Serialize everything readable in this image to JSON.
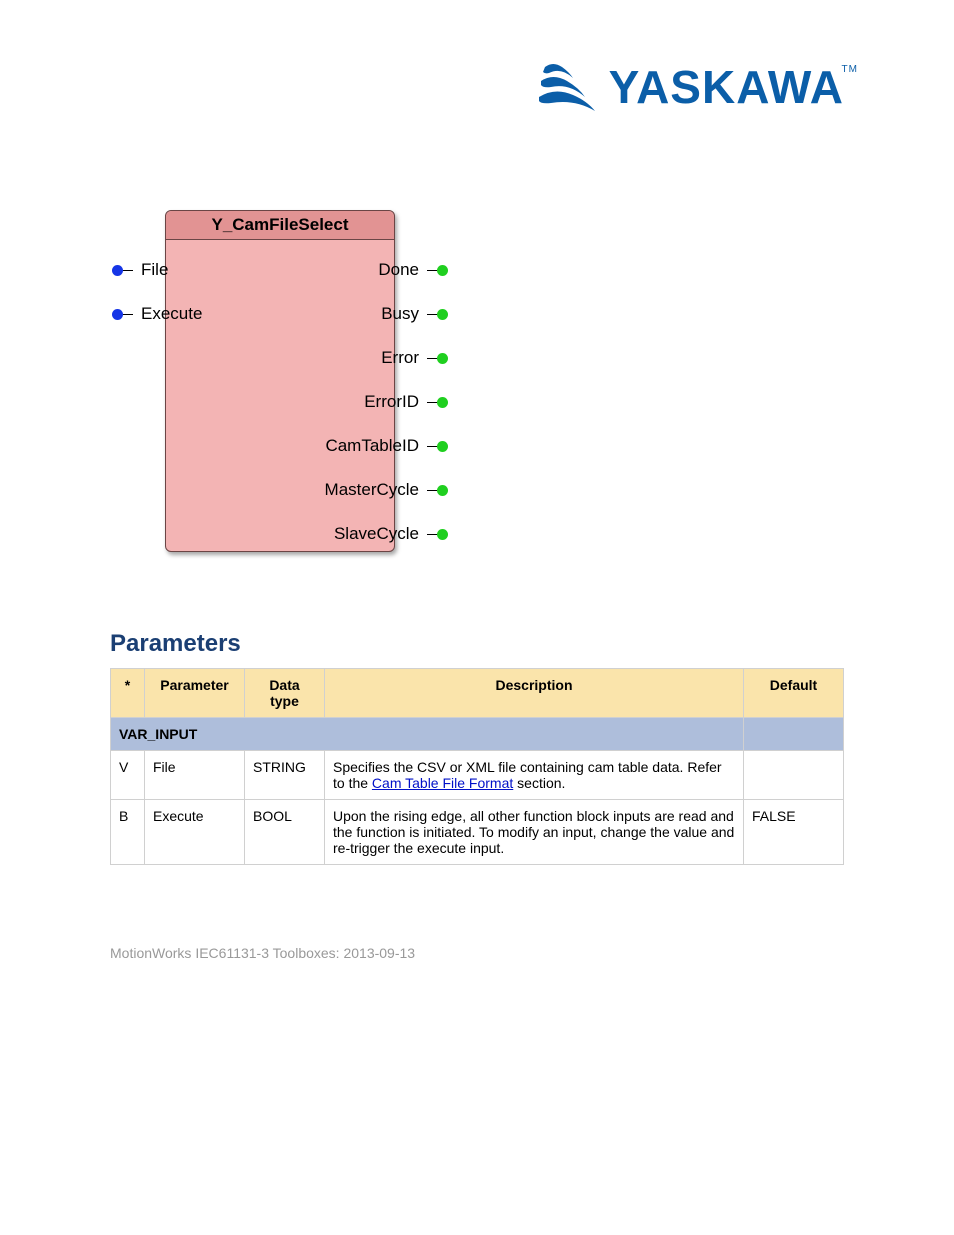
{
  "logo": {
    "text": "YASKAWA",
    "tm": "TM"
  },
  "block": {
    "title": "Y_CamFileSelect",
    "inputs": [
      "File",
      "Execute"
    ],
    "outputs": [
      "Done",
      "Busy",
      "Error",
      "ErrorID",
      "CamTableID",
      "MasterCycle",
      "SlaveCycle"
    ]
  },
  "parameters_heading": "Parameters",
  "columns": [
    "*",
    "Parameter",
    "Data type",
    "Description",
    "Default"
  ],
  "subhead": "VAR_INPUT",
  "rows": [
    {
      "star": "V",
      "param": "File",
      "dtype": "STRING",
      "desc_pre": "Specifies the CSV or XML file containing cam table data. Refer to the ",
      "link1": "Cam Table File Format",
      "desc_post": " section.",
      "default": ""
    },
    {
      "star": "B",
      "param": "Execute",
      "dtype": "BOOL",
      "desc_pre": "Upon the rising edge, all other function block inputs are read and the function is initiated. To modify an input, change the value and re-trigger the execute input.",
      "link1": "",
      "desc_post": "",
      "default": "FALSE"
    }
  ],
  "footer": "MotionWorks IEC61131-3 Toolboxes: 2013-09-13"
}
